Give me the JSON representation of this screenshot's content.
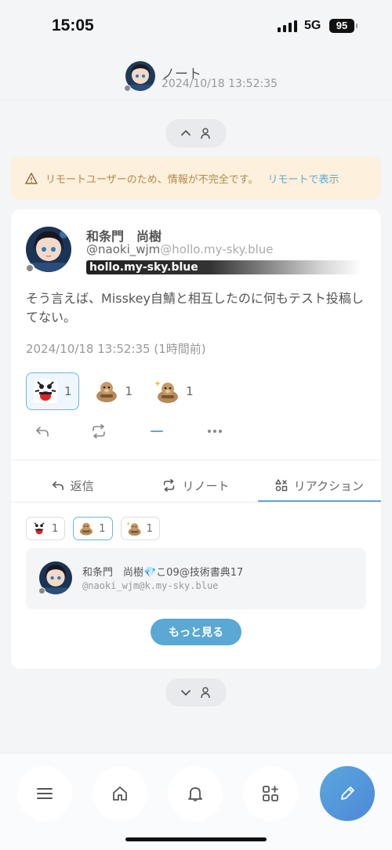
{
  "status_bar": {
    "time": "15:05",
    "network": "5G",
    "battery": "95"
  },
  "header": {
    "title": "ノート",
    "date": "2024/10/18 13:52:35"
  },
  "warning": {
    "text": "リモートユーザーのため、情報が不完全です。",
    "link": "リモートで表示"
  },
  "note": {
    "name": "和条門　尚樹",
    "handle_user": "@naoki_wjm",
    "handle_host": "@hollo.my-sky.blue",
    "instance": "hollo.my-sky.blue",
    "text": "そう言えば、Misskey自鯖と相互したのに何もテスト投稿してない。",
    "date": "2024/10/18 13:52:35 (1時間前)",
    "reactions": [
      {
        "emoji": "bug-face-emoji",
        "count": "1",
        "active": true
      },
      {
        "emoji": "otter-emoji",
        "count": "1",
        "active": false
      },
      {
        "emoji": "otter-sparkle-emoji",
        "count": "1",
        "active": false
      }
    ],
    "renote_count_placeholder": "—"
  },
  "tabs": [
    {
      "label": "返信",
      "icon": "reply-icon"
    },
    {
      "label": "リノート",
      "icon": "repeat-icon"
    },
    {
      "label": "リアクション",
      "icon": "shapes-icon",
      "active": true
    }
  ],
  "reaction_list": {
    "chips": [
      {
        "emoji": "bug-face-emoji",
        "count": "1"
      },
      {
        "emoji": "otter-emoji",
        "count": "1"
      },
      {
        "emoji": "otter-sparkle-emoji",
        "count": "1"
      }
    ],
    "user": {
      "name": "和条門　尚樹💎こ09@技術書典17",
      "handle": "@naoki_wjm@k.my-sky.blue"
    },
    "more_label": "もっと見る"
  },
  "colors": {
    "accent": "#5ba8d4",
    "warning_bg": "#fdf0dc",
    "warning_text": "#b08a4a"
  }
}
